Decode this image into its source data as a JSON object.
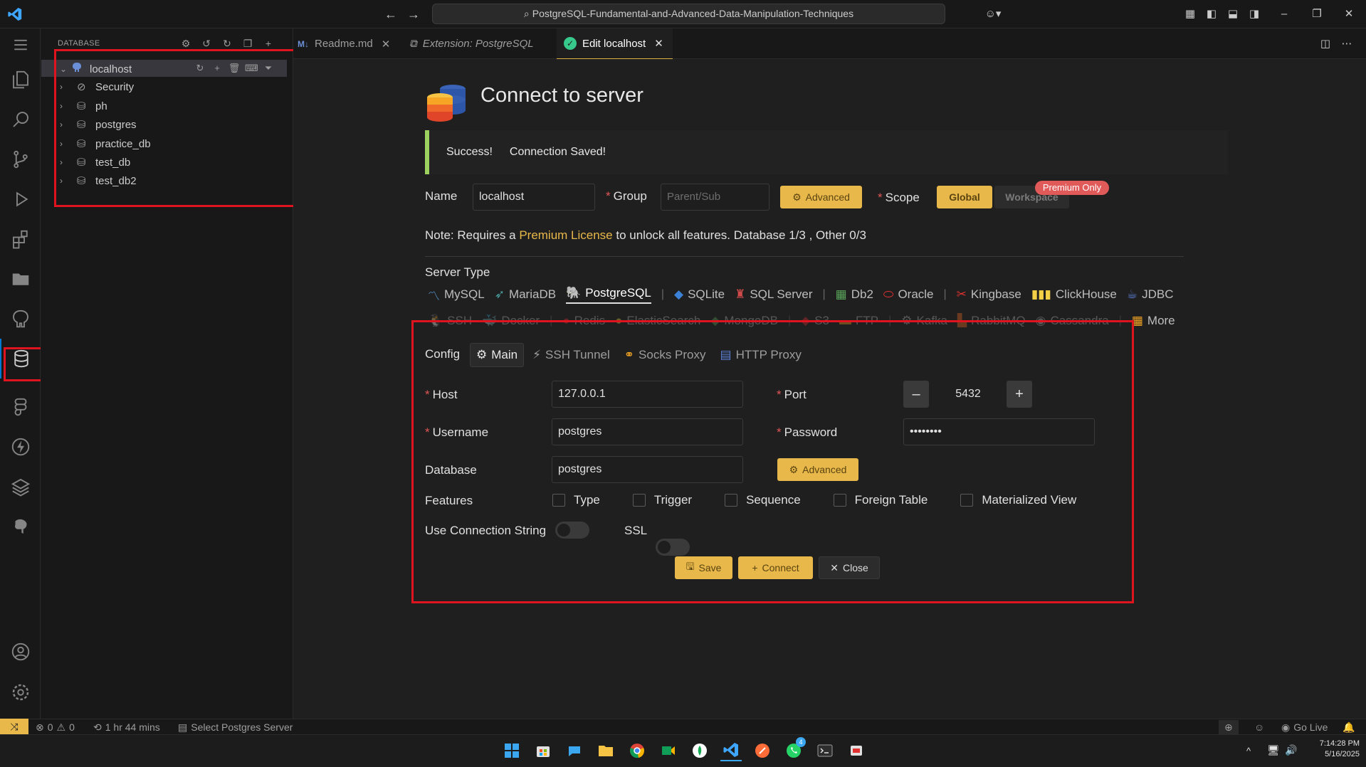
{
  "titlebar": {
    "title": "PostgreSQL-Fundamental-and-Advanced-Data-Manipulation-Techniques"
  },
  "sidebar": {
    "title": "DATABASE",
    "root": "localhost",
    "items": [
      {
        "label": "Security"
      },
      {
        "label": "ph"
      },
      {
        "label": "postgres"
      },
      {
        "label": "practice_db"
      },
      {
        "label": "test_db"
      },
      {
        "label": "test_db2"
      }
    ]
  },
  "tabs": [
    {
      "label": "Readme.md"
    },
    {
      "label": "Extension: PostgreSQL"
    },
    {
      "label": "Edit localhost"
    }
  ],
  "form": {
    "title": "Connect to server",
    "success_label": "Success!",
    "success_message": "Connection Saved!",
    "name_label": "Name",
    "name_value": "localhost",
    "group_label": "Group",
    "group_placeholder": "Parent/Sub",
    "advanced_label": "Advanced",
    "scope_label": "Scope",
    "scope_global": "Global",
    "scope_workspace": "Workspace",
    "premium_badge": "Premium Only",
    "note_prefix": "Note: Requires a",
    "note_link": "Premium License",
    "note_suffix": "to unlock all features. Database 1/3 , Other 0/3",
    "server_type_label": "Server Type",
    "server_types_row1": [
      "MySQL",
      "MariaDB",
      "PostgreSQL",
      "SQLite",
      "SQL Server",
      "Db2",
      "Oracle",
      "Kingbase",
      "ClickHouse",
      "JDBC"
    ],
    "server_types_row2": [
      "SSH",
      "Docker",
      "Redis",
      "ElasticSearch",
      "MongoDB",
      "S3",
      "FTP",
      "Kafka",
      "RabbitMQ",
      "Cassandra",
      "More"
    ],
    "config_label": "Config",
    "config_tabs": [
      "Main",
      "SSH Tunnel",
      "Socks Proxy",
      "HTTP Proxy"
    ],
    "host_label": "Host",
    "host_value": "127.0.0.1",
    "port_label": "Port",
    "port_value": "5432",
    "username_label": "Username",
    "username_value": "postgres",
    "password_label": "Password",
    "password_value": "••••••••",
    "database_label": "Database",
    "database_value": "postgres",
    "features_label": "Features",
    "features": [
      "Type",
      "Trigger",
      "Sequence",
      "Foreign Table",
      "Materialized View"
    ],
    "use_conn_string_label": "Use Connection String",
    "ssl_label": "SSL",
    "save_label": "Save",
    "connect_label": "Connect",
    "close_label": "Close"
  },
  "statusbar": {
    "errors": "0",
    "warnings": "0",
    "time": "1 hr 44 mins",
    "select_server": "Select Postgres Server",
    "go_live": "Go Live"
  },
  "taskbar": {
    "time": "7:14:28 PM",
    "date": "5/16/2025",
    "badge": "4"
  },
  "colors": {
    "accent_gold": "#e8b84a",
    "success_green": "#9bd15c",
    "highlight_red": "#e0141e",
    "premium_red": "#e05a5a"
  }
}
